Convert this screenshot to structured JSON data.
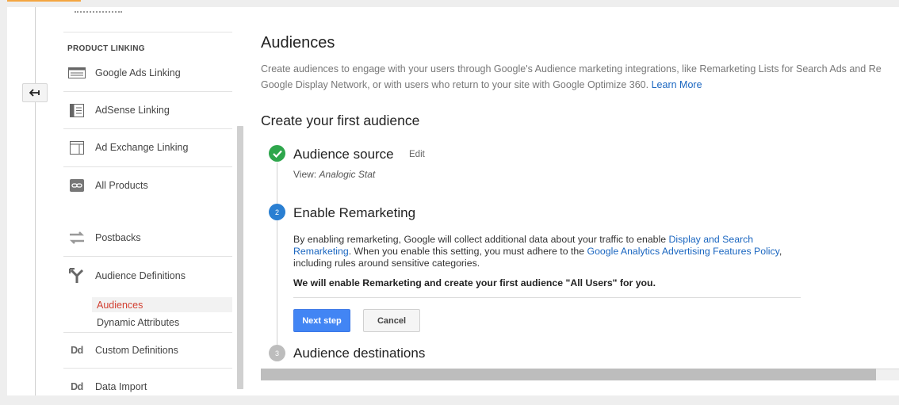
{
  "sidebar": {
    "section_title": "PRODUCT LINKING",
    "items": [
      {
        "label": "Google Ads Linking",
        "icon": "google-ads-icon"
      },
      {
        "label": "AdSense Linking",
        "icon": "adsense-icon"
      },
      {
        "label": "Ad Exchange Linking",
        "icon": "ad-exchange-icon"
      },
      {
        "label": "All Products",
        "icon": "link-icon"
      },
      {
        "label": "Postbacks",
        "icon": "postbacks-icon"
      },
      {
        "label": "Audience Definitions",
        "icon": "audience-definitions-icon"
      },
      {
        "label": "Custom Definitions",
        "icon": "dd-icon"
      },
      {
        "label": "Data Import",
        "icon": "dd-icon"
      }
    ],
    "subitems": [
      {
        "label": "Audiences",
        "active": true
      },
      {
        "label": "Dynamic Attributes",
        "active": false
      }
    ],
    "dd_glyph": "Dd"
  },
  "main": {
    "title": "Audiences",
    "description_line1": "Create audiences to engage with your users through Google's Audience marketing integrations, like Remarketing Lists for Search Ads and Re",
    "description_line2": "Google Display Network, or with users who return to your site with Google Optimize 360.",
    "learn_more": "Learn More",
    "subtitle": "Create your first audience",
    "steps": [
      {
        "number": "",
        "title": "Audience source",
        "state": "done"
      },
      {
        "number": "2",
        "title": "Enable Remarketing",
        "state": "current"
      },
      {
        "number": "3",
        "title": "Audience destinations",
        "state": "pending"
      }
    ],
    "edit_label": "Edit",
    "view_prefix": "View:",
    "view_value": "Analogic Stat",
    "body": {
      "part1": "By enabling remarketing, Google will collect additional data about your traffic to enable ",
      "link1": "Display and Search Remarketing",
      "part2": ". When you enable this setting, you must adhere to the ",
      "link2": "Google Analytics Advertising Features Policy",
      "part3": ", including rules around sensitive categories."
    },
    "bold_note": "We will enable Remarketing and create your first audience \"All Users\" for you.",
    "next_button": "Next step",
    "cancel_button": "Cancel"
  },
  "colors": {
    "accent_orange": "#f4a641",
    "link_blue": "#1a66c0",
    "primary_button": "#4285f4",
    "done_green": "#2ea64c",
    "current_blue": "#2a7fd2",
    "active_red": "#d23f31"
  }
}
